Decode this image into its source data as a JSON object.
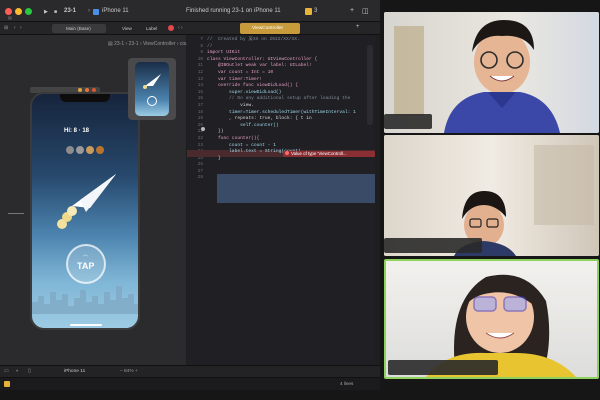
{
  "window": {
    "scheme": "23-1",
    "device": "iPhone 11",
    "status_message": "Finished running 23-1 on iPhone 11",
    "warnings": "3"
  },
  "tabs": {
    "storyboard": "Main (Base)",
    "jump_view": "View",
    "jump_label": "Label",
    "editor_file": "ViewController",
    "breadcrumb": [
      "23-1",
      "23-1",
      "ViewController",
      "counter()"
    ]
  },
  "game": {
    "score": "Hi: 8 · 18",
    "tap_label": "TAP"
  },
  "code": {
    "line_numbers": [
      "7",
      "8",
      "9",
      "10",
      "11",
      "12",
      "13",
      "14",
      "15",
      "16",
      "17",
      "18",
      "19",
      "20",
      "21",
      "22",
      "23",
      "24",
      "25",
      "26",
      "27",
      "28"
    ],
    "lines": [
      "//  Created by 吴XX on 2022/XX/XX.",
      "//",
      "",
      "import UIKit",
      "",
      "class ViewController: UIViewController {",
      "    @IBOutlet weak var label: UILabel!",
      "    var count = Int = 10",
      "    var timer:Timer!",
      "    override func viewDidLoad() {",
      "        super.viewDidLoad()",
      "        // Do any additional setup after loading the",
      "            view.",
      "        timer=Timer.scheduledTimer(withTimeInterval: 1",
      "        , repeats: true, block: { t in",
      "            self.counter()",
      "    })",
      "",
      "    func counter(){",
      "        count = count - 1",
      "        label.text = String(count)",
      "    }"
    ],
    "error_text": "Value of type 'ViewControll..."
  },
  "canvas_bottom": {
    "device": "iPhone 11",
    "zoom": "– 84% +"
  },
  "debug": {
    "filter": "4 lines"
  },
  "colors": {
    "accent": "#2f7cf6",
    "error": "#e5484d",
    "active_speaker": "#8ed15c"
  }
}
